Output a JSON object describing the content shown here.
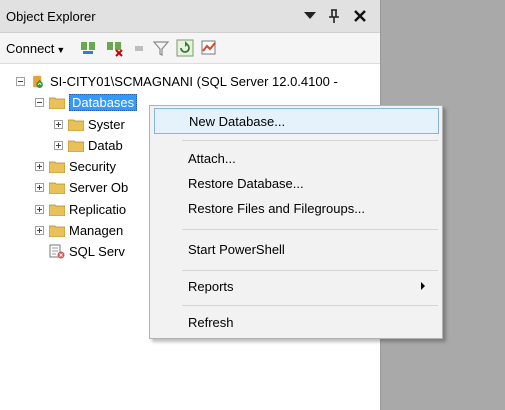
{
  "window": {
    "title": "Object Explorer"
  },
  "toolbar": {
    "connect_label": "Connect",
    "icons": [
      "connect-icon",
      "disconnect-icon",
      "stop-icon",
      "filter-icon",
      "refresh-icon",
      "activity-monitor-icon"
    ]
  },
  "tree": {
    "server": "SI-CITY01\\SCMAGNANI (SQL Server 12.0.4100 -",
    "databases": "Databases",
    "system_db": "Syster",
    "db_snapshots": "Datab",
    "security": "Security",
    "server_objects": "Server Ob",
    "replication": "Replicatio",
    "management": "Managen",
    "sql_agent": "SQL Serv"
  },
  "context_menu": {
    "new_database": "New Database...",
    "attach": "Attach...",
    "restore_database": "Restore Database...",
    "restore_files": "Restore Files and Filegroups...",
    "start_powershell": "Start PowerShell",
    "reports": "Reports",
    "refresh": "Refresh"
  },
  "colors": {
    "selection": "#3399ff",
    "menu_hover": "#e5f1fb",
    "folder": "#e8c15a",
    "right_pane": "#a9a9a9"
  }
}
